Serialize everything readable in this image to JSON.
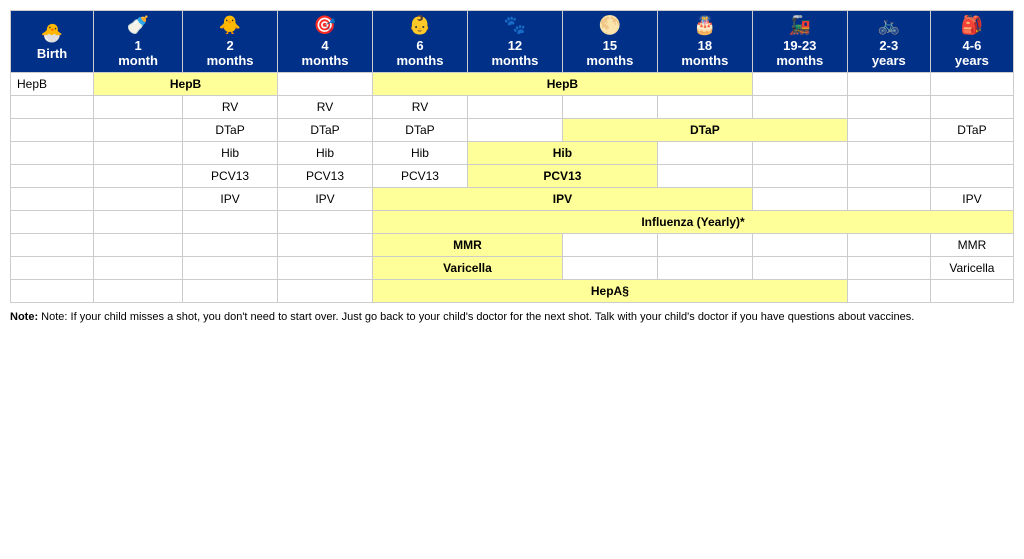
{
  "table": {
    "headers": [
      {
        "id": "birth",
        "icon": "🐣",
        "line1": "Birth",
        "line2": ""
      },
      {
        "id": "1m",
        "icon": "🍼",
        "line1": "1",
        "line2": "month"
      },
      {
        "id": "2m",
        "icon": "🐥",
        "line1": "2",
        "line2": "months"
      },
      {
        "id": "4m",
        "icon": "🎯",
        "line1": "4",
        "line2": "months"
      },
      {
        "id": "6m",
        "icon": "👶",
        "line1": "6",
        "line2": "months"
      },
      {
        "id": "12m",
        "icon": "🐾",
        "line1": "12",
        "line2": "months"
      },
      {
        "id": "15m",
        "icon": "🌕",
        "line1": "15",
        "line2": "months"
      },
      {
        "id": "18m",
        "icon": "🎂",
        "line1": "18",
        "line2": "months"
      },
      {
        "id": "19_23m",
        "icon": "🚂",
        "line1": "19-23",
        "line2": "months"
      },
      {
        "id": "2_3y",
        "icon": "🚲",
        "line1": "2-3",
        "line2": "years"
      },
      {
        "id": "4_6y",
        "icon": "🎒",
        "line1": "4-6",
        "line2": "years"
      }
    ],
    "note": "Note: If your child misses a shot, you don't need to start over. Just go back to your child's doctor for the next shot. Talk with your child's doctor if you have questions about vaccines."
  }
}
